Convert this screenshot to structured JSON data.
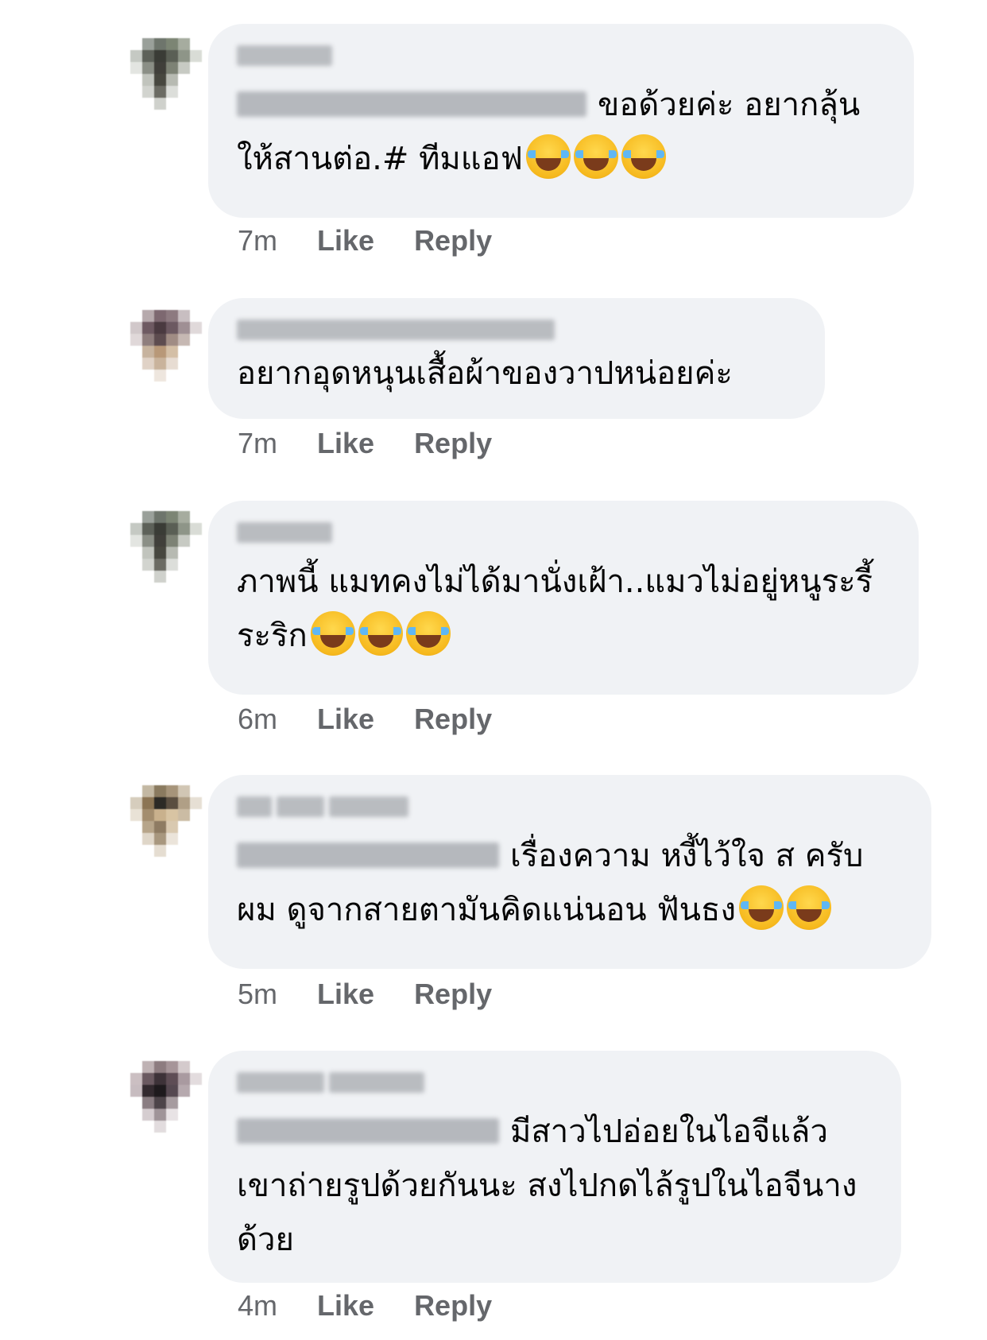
{
  "comments": [
    {
      "text": "ขอด้วยค่ะ อยากลุ้น ให้สานต่อ.# ทีมแอฟ",
      "emoji_count": 3,
      "emoji_icon": "face-with-tears-of-joy-icon",
      "time": "7m",
      "like_label": "Like",
      "reply_label": "Reply"
    },
    {
      "text": "อยากอุดหนุนเสื้อผ้าของวาปหน่อยค่ะ",
      "emoji_count": 0,
      "time": "7m",
      "like_label": "Like",
      "reply_label": "Reply"
    },
    {
      "text": "ภาพนี้ แมทคงไม่ได้มานั่งเฝ้า..แมวไม่อยู่หนูระรี้ระริก",
      "emoji_count": 3,
      "emoji_icon": "face-with-tears-of-joy-icon",
      "time": "6m",
      "like_label": "Like",
      "reply_label": "Reply"
    },
    {
      "text": "เรื่องความ หงี้ไว้ใจ ส ครับ ผม ดูจากสายตามันคิดแน่นอน ฟันธง",
      "emoji_count": 2,
      "emoji_icon": "face-with-tears-of-joy-icon",
      "time": "5m",
      "like_label": "Like",
      "reply_label": "Reply"
    },
    {
      "text": "มีสาวไปอ่อยในไอจีแล้ว เขาถ่ายรูปด้วยกันนะ สงไปกดไล้รูปในไอจีนางด้วย",
      "emoji_count": 0,
      "time": "4m",
      "like_label": "Like",
      "reply_label": "Reply"
    }
  ]
}
